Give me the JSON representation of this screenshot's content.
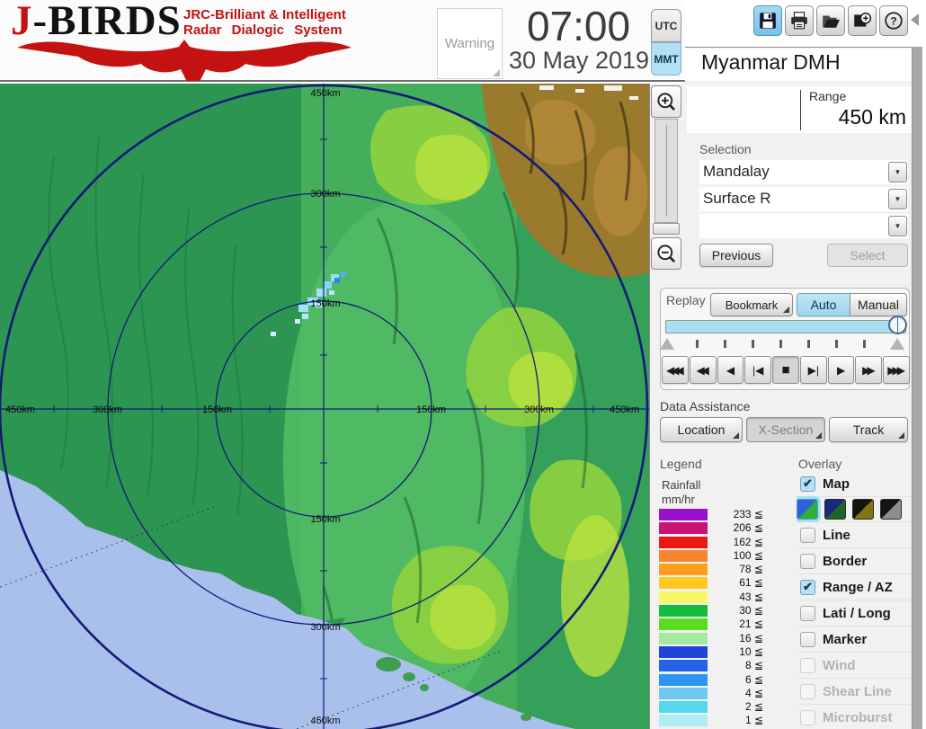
{
  "header": {
    "logo": {
      "title_j": "J",
      "title_rest": "-BIRDS",
      "subtitle_line1": "JRC-Brilliant & Intelligent",
      "subtitle_line2": "Radar Dialogic System"
    },
    "warning_label": "Warning",
    "time": "07:00",
    "date": "30 May 2019",
    "tz_utc": "UTC",
    "tz_mmt": "MMT",
    "selected_tz": "MMT",
    "toolbar_icons": [
      "save-icon",
      "print-icon",
      "open-folder-icon",
      "add-image-icon",
      "help-icon"
    ]
  },
  "panel": {
    "site": "Myanmar DMH",
    "range_label": "Range",
    "range_value": "450 km",
    "selection_label": "Selection",
    "dropdowns": [
      {
        "value": "Mandalay"
      },
      {
        "value": "Surface R"
      },
      {
        "value": ""
      }
    ],
    "previous": "Previous",
    "select": "Select",
    "replay": {
      "label": "Replay",
      "bookmark": "Bookmark",
      "auto": "Auto",
      "manual": "Manual",
      "mode": "Auto",
      "transport": [
        "◀◀◀",
        "◀◀",
        "◀",
        "|◀",
        "■",
        "▶|",
        "▶",
        "▶▶",
        "▶▶▶"
      ],
      "active_transport": "■"
    },
    "data_assistance": {
      "label": "Data Assistance",
      "location": "Location",
      "xsection": "X-Section",
      "track": "Track",
      "xsection_state": "pressed"
    },
    "legend": {
      "label": "Legend",
      "unit_line1": "Rainfall",
      "unit_line2": "mm/hr",
      "items": [
        {
          "value": "233 ≦",
          "style": "background:#9911cc"
        },
        {
          "value": "206 ≦",
          "style": "background:#cc1177"
        },
        {
          "value": "162 ≦",
          "style": "background:#ee1611"
        },
        {
          "value": "100 ≦",
          "style": "background:#f8842d"
        },
        {
          "value": "78 ≦",
          "style": "background:#ff9d1e"
        },
        {
          "value": "61 ≦",
          "style": "background:#ffc81e"
        },
        {
          "value": "43 ≦",
          "style": "background:#f8f862"
        },
        {
          "value": "30 ≦",
          "style": "background:#12bd3c"
        },
        {
          "value": "21 ≦",
          "style": "background:#58dd22"
        },
        {
          "value": "16 ≦",
          "style": "background:#a5e8a0"
        },
        {
          "value": "10 ≦",
          "style": "background:#2143d8"
        },
        {
          "value": "8 ≦",
          "style": "background:#2463e8"
        },
        {
          "value": "6 ≦",
          "style": "background:#2e94f0"
        },
        {
          "value": "4 ≦",
          "style": "background:#6ec8f2"
        },
        {
          "value": "2 ≦",
          "style": "background:#55d8ee"
        },
        {
          "value": "1 ≦",
          "style": "background:#aceef4"
        }
      ]
    },
    "overlay": {
      "label": "Overlay",
      "items": [
        {
          "label": "Map",
          "checked": true,
          "enabled": true
        },
        {
          "label": "Line",
          "checked": false,
          "enabled": true
        },
        {
          "label": "Border",
          "checked": false,
          "enabled": true
        },
        {
          "label": "Range / AZ",
          "checked": true,
          "enabled": true
        },
        {
          "label": "Lati / Long",
          "checked": false,
          "enabled": true
        },
        {
          "label": "Marker",
          "checked": false,
          "enabled": true
        },
        {
          "label": "Wind",
          "checked": false,
          "enabled": false
        },
        {
          "label": "Shear Line",
          "checked": false,
          "enabled": false
        },
        {
          "label": "Microburst",
          "checked": false,
          "enabled": false
        }
      ],
      "map_themes": [
        {
          "style": "background:linear-gradient(135deg,#2f62d8 50%,#2fae3c 50%)",
          "selected": true
        },
        {
          "style": "background:linear-gradient(135deg,#18297e 50%,#1d6626 50%)",
          "selected": false
        },
        {
          "style": "background:linear-gradient(135deg,#16150d 50%,#847413 50%)",
          "selected": false
        },
        {
          "style": "background:linear-gradient(135deg,#131318 50%,#8d8d8d 50%)",
          "selected": false
        }
      ]
    }
  },
  "map": {
    "rings_km": [
      "150km",
      "300km",
      "450km"
    ],
    "v_labels": [
      "450km",
      "300km",
      "150km",
      "150km",
      "300km",
      "450km"
    ],
    "h_labels": [
      "450km",
      "300km",
      "150km",
      "150km",
      "300km",
      "450km"
    ]
  },
  "colors": {
    "accent_blue": "#a9def3",
    "ring_navy": "#141a78",
    "sea": "#a9c0ec",
    "logo_red": "#c41212",
    "panel_grey": "#f1f1f1"
  }
}
